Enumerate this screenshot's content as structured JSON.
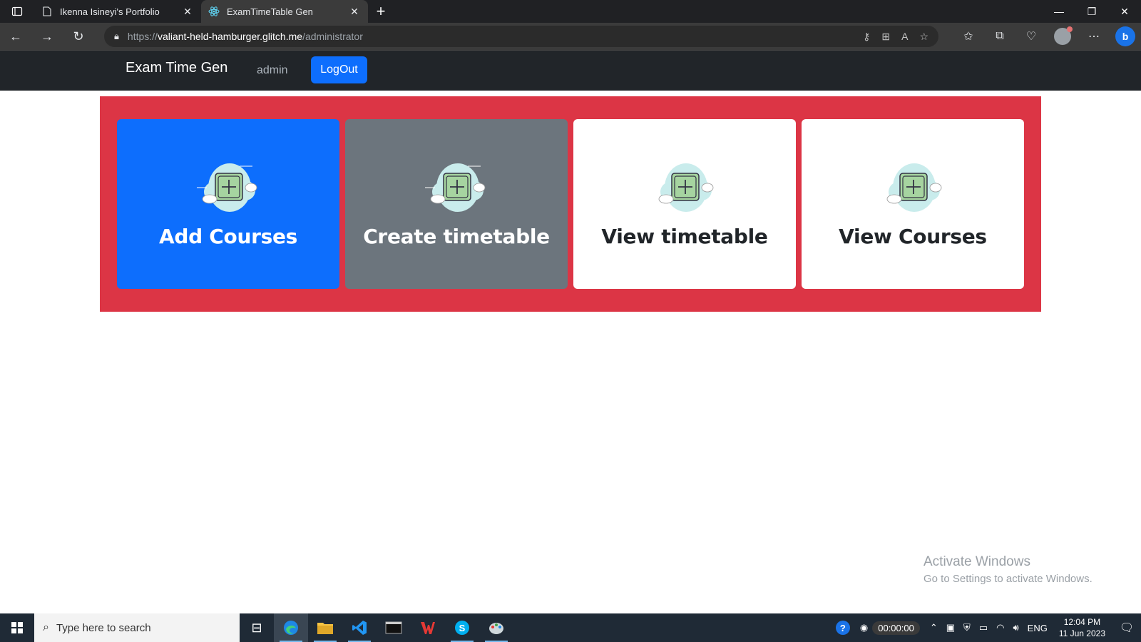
{
  "browser": {
    "tabs": [
      {
        "title": "Ikenna Isineyi's Portfolio",
        "icon": "page-icon",
        "active": false
      },
      {
        "title": "ExamTimeTable Gen",
        "icon": "react-icon",
        "active": true
      }
    ],
    "url_prefix": "https://",
    "url_host": "valiant-held-hamburger.glitch.me",
    "url_path": "/administrator"
  },
  "navbar": {
    "brand": "Exam Time Gen",
    "admin_link": "admin",
    "logout_label": "LogOut"
  },
  "cards": [
    {
      "label": "Add Courses",
      "bg": "#0d6efd"
    },
    {
      "label": "Create timetable",
      "bg": "#6c757d"
    },
    {
      "label": "View timetable",
      "bg": "#ffffff"
    },
    {
      "label": "View Courses",
      "bg": "#ffffff"
    }
  ],
  "watermark": {
    "line1": "Activate Windows",
    "line2": "Go to Settings to activate Windows."
  },
  "taskbar": {
    "search_placeholder": "Type here to search",
    "timer": "00:00:00",
    "language": "ENG",
    "time": "12:04 PM",
    "date": "11 Jun 2023"
  },
  "colors": {
    "panel_red": "#dc3545",
    "navbar_dark": "#212529",
    "primary_blue": "#0d6efd"
  }
}
